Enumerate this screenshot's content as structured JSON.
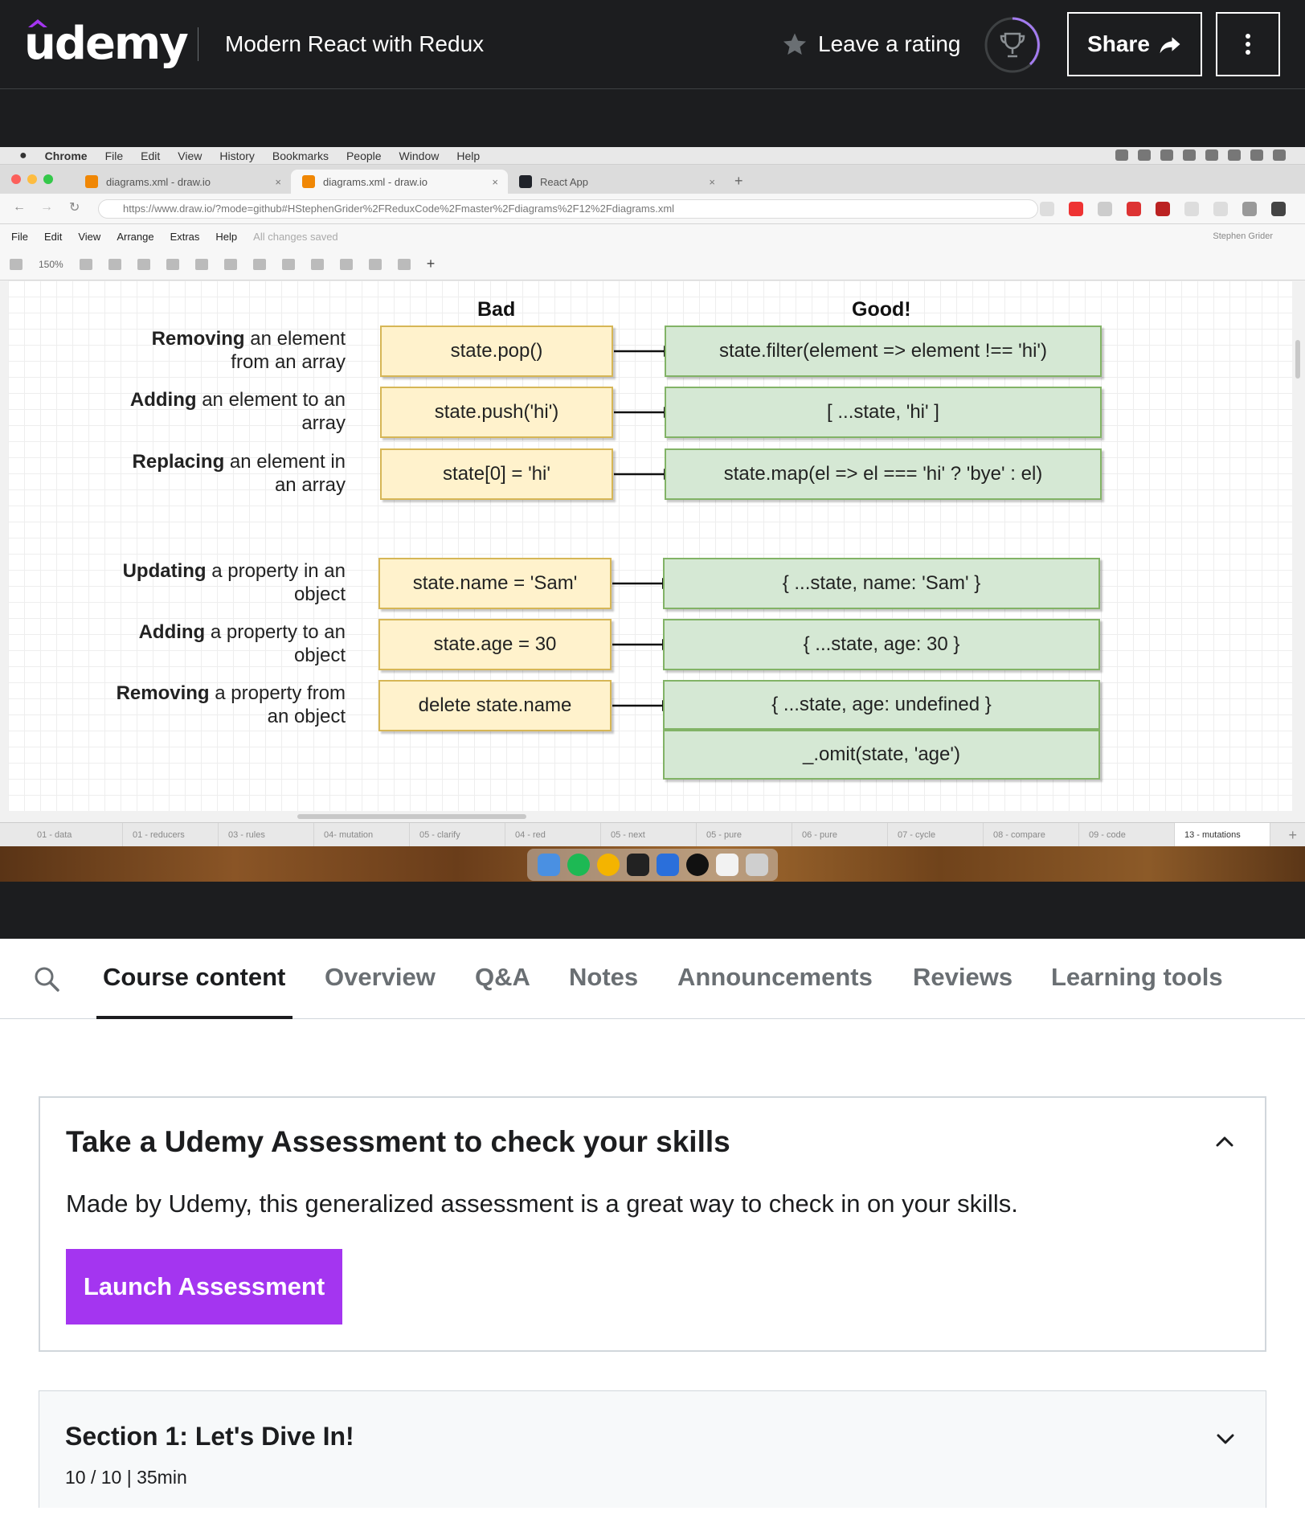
{
  "header": {
    "logo_text": "udemy",
    "course_title": "Modern React with Redux",
    "rating_label": "Leave a rating",
    "share_label": "Share",
    "colors": {
      "background": "#1c1d1f",
      "accent": "#a435f0",
      "progress_ring": "#a47cf0"
    }
  },
  "video": {
    "mac_menu": [
      "Chrome",
      "File",
      "Edit",
      "View",
      "History",
      "Bookmarks",
      "People",
      "Window",
      "Help"
    ],
    "browser_tabs": [
      "diagrams.xml - draw.io",
      "diagrams.xml - draw.io",
      "React App"
    ],
    "url": "https://www.draw.io/?mode=github#HStephenGrider%2FReduxCode%2Fmaster%2Fdiagrams%2F12%2Fdiagrams.xml",
    "url_host": "www.draw.io",
    "app_menu": [
      "File",
      "Edit",
      "View",
      "Arrange",
      "Extras",
      "Help"
    ],
    "save_status": "All changes saved",
    "user_name": "Stephen Grider",
    "zoom": "150%",
    "diagram": {
      "bad_heading": "Bad",
      "good_heading": "Good!",
      "rows": [
        {
          "label_bold": "Removing",
          "label_rest": " an element from an array",
          "bad": "state.pop()",
          "good": [
            "state.filter(element => element !== 'hi')"
          ]
        },
        {
          "label_bold": "Adding",
          "label_rest": " an element to an array",
          "bad": "state.push('hi')",
          "good": [
            "[ ...state, 'hi' ]"
          ]
        },
        {
          "label_bold": "Replacing",
          "label_rest": " an element in an array",
          "bad": "state[0] = 'hi'",
          "good": [
            "state.map(el => el === 'hi' ? 'bye' : el)"
          ]
        },
        {
          "label_bold": "Updating",
          "label_rest": " a property in an object",
          "bad": "state.name = 'Sam'",
          "good": [
            "{ ...state, name: 'Sam' }"
          ]
        },
        {
          "label_bold": "Adding",
          "label_rest": " a property to an object",
          "bad": "state.age = 30",
          "good": [
            "{ ...state, age: 30 }"
          ]
        },
        {
          "label_bold": "Removing",
          "label_rest": " a property from an object",
          "bad": "delete state.name",
          "good": [
            "{ ...state, age: undefined }",
            "_.omit(state, 'age')"
          ]
        }
      ],
      "colors": {
        "bad_fill": "#fff2cc",
        "bad_stroke": "#d6b656",
        "good_fill": "#d5e8d4",
        "good_stroke": "#82b366"
      }
    },
    "page_tabs": [
      "01 - data",
      "01 - reducers",
      "03 - rules",
      "04- mutation",
      "05 - clarify",
      "04 - red",
      "05 - next",
      "05 - pure",
      "06 - pure",
      "07 - cycle",
      "08 - compare",
      "09 - code",
      "13 - mutations"
    ],
    "active_page_tab": "13 - mutations"
  },
  "course_tabs": [
    "Course content",
    "Overview",
    "Q&A",
    "Notes",
    "Announcements",
    "Reviews",
    "Learning tools"
  ],
  "active_course_tab": "Course content",
  "assessment": {
    "title": "Take a Udemy Assessment to check your skills",
    "description": "Made by Udemy, this generalized assessment is a great way to check in on your skills.",
    "button_label": "Launch Assessment"
  },
  "section": {
    "title": "Section 1: Let's Dive In!",
    "meta": "10 / 10 | 35min"
  }
}
